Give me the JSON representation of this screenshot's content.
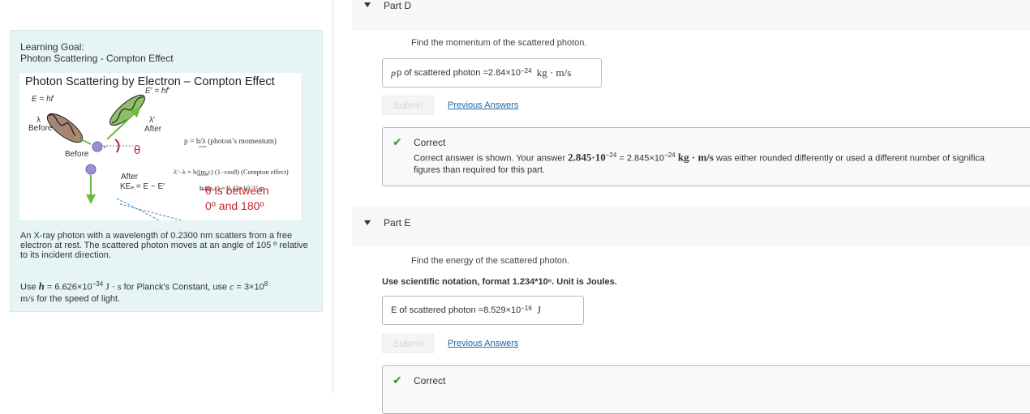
{
  "learning_goal": {
    "title": "Learning Goal:",
    "subtitle": "Photon Scattering - Compton Effect",
    "figure": {
      "title": "Photon Scattering by Electron – Compton Effect",
      "e_hf": "E = hf",
      "e_prime": "E′ = hf′",
      "lambda": "λ",
      "lambda_prime": "λ′",
      "before_1": "Before",
      "after_1": "After",
      "before_2": "Before",
      "after_2": "After",
      "theta": "θ",
      "ke": "KEₑ = E − E′",
      "momentum_formula": "p = h/λ  (photon’s momentum)",
      "compton_formula": "λ′−λ = h/(mₑc) (1−cosθ) (Compton effect)",
      "compton_const": "h/(mₑc) = 2.43×10⁻¹² m",
      "theta_range_1": "θ is between",
      "theta_range_2": "0º and 180º"
    },
    "problem_text": "An X-ray photon with a wavelength of 0.2300 nm scatters from a free electron at rest. The scattered photon moves at an angle of 105 º relative to its incident direction.",
    "constants_prefix": "Use ",
    "planck_symbol": "h",
    "planck_value": " = 6.626×10",
    "planck_exp": "−34",
    "planck_unit": " J · s",
    "planck_suffix": " for Planck's Constant, use ",
    "c_symbol": "c",
    "c_value": " = 3×10",
    "c_exp": "8",
    "c_unit": "m/s",
    "c_suffix": " for the speed of light."
  },
  "part_d": {
    "title": "Part D",
    "instruction": "Find the momentum of the scattered photon.",
    "answer_label": "p of scattered photon = ",
    "answer_value": "2.84×10",
    "answer_exp": "−24",
    "answer_unit": "kg · m/s",
    "submit_label": "Submit",
    "previous_answers_label": "Previous Answers",
    "feedback_title": "Correct",
    "feedback_prefix": "Correct answer is shown. Your answer ",
    "feedback_your": "2.845·10",
    "feedback_your_exp": "−24",
    "feedback_eq": " = 2.845×10",
    "feedback_eq_exp": "−24",
    "feedback_unit": " kg · m/s",
    "feedback_suffix": " was either rounded differently or used a different number of significa",
    "feedback_line2": "figures than required for this part."
  },
  "part_e": {
    "title": "Part E",
    "instruction": "Find the energy of the scattered photon.",
    "format_note": "Use scientific notation, format 1.234*10ⁿ. Unit is Joules.",
    "answer_label": "E of scattered photon = ",
    "answer_value": "8.529×10",
    "answer_exp": "−16",
    "answer_unit": "J",
    "submit_label": "Submit",
    "previous_answers_label": "Previous Answers",
    "feedback_title": "Correct"
  }
}
